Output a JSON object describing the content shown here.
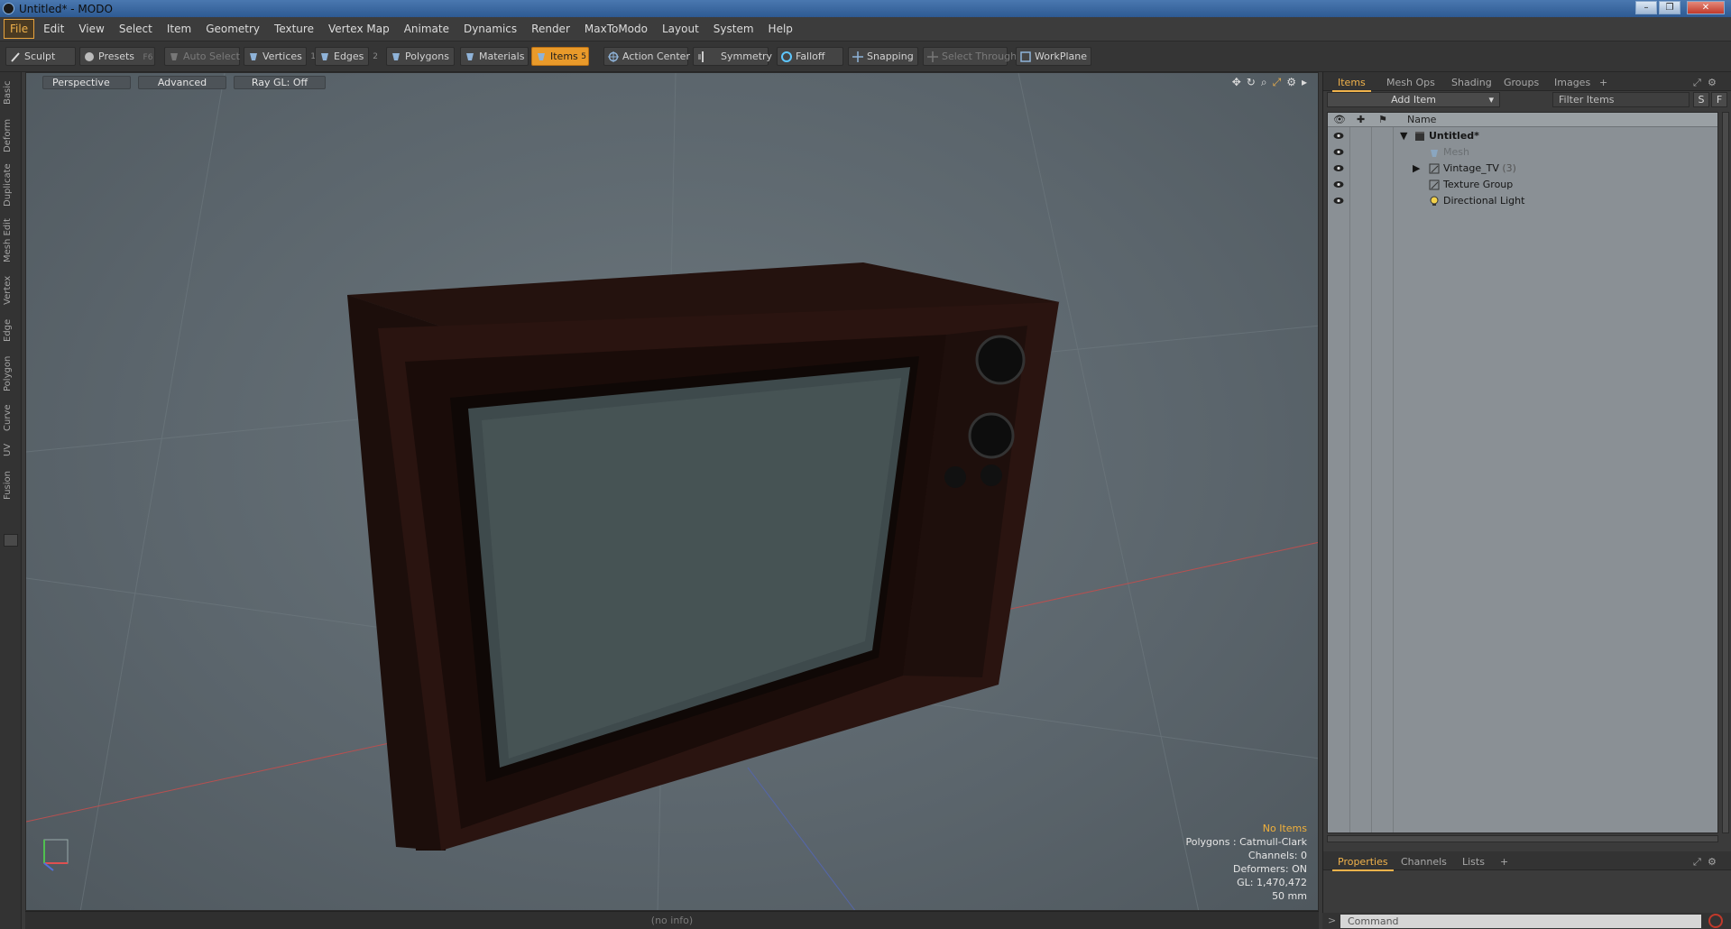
{
  "window": {
    "title": "Untitled* - MODO"
  },
  "menu": [
    "File",
    "Edit",
    "View",
    "Select",
    "Item",
    "Geometry",
    "Texture",
    "Vertex Map",
    "Animate",
    "Dynamics",
    "Render",
    "MaxToModo",
    "Layout",
    "System",
    "Help"
  ],
  "toolbar": {
    "sculpt": "Sculpt",
    "presets": "Presets",
    "presets_key": "F6",
    "auto_select": "Auto Select",
    "vertices": "Vertices",
    "vertices_num": "1",
    "edges": "Edges",
    "edges_num": "2",
    "polygons": "Polygons",
    "materials": "Materials",
    "items": "Items",
    "items_num": "5",
    "action_center": "Action Center",
    "symmetry": "Symmetry",
    "falloff": "Falloff",
    "snapping": "Snapping",
    "select_through": "Select Through",
    "workplane": "WorkPlane"
  },
  "left_tabs": [
    "Basic",
    "Deform",
    "Duplicate",
    "Mesh Edit",
    "Vertex",
    "Edge",
    "Polygon",
    "Curve",
    "UV",
    "Fusion"
  ],
  "viewport": {
    "view": "Perspective",
    "shading": "Advanced",
    "raygl": "Ray GL: Off",
    "info": {
      "selection": "No Items",
      "polygons": "Polygons : Catmull-Clark",
      "channels": "Channels: 0",
      "deformers": "Deformers: ON",
      "gl": "GL: 1,470,472",
      "lens": "50 mm"
    }
  },
  "status": {
    "text": "(no info)"
  },
  "right_panel": {
    "tabs": [
      "Items",
      "Mesh Ops",
      "Shading",
      "Groups",
      "Images"
    ],
    "add_item": "Add Item",
    "filter_placeholder": "Filter Items",
    "btn_s": "S",
    "btn_f": "F",
    "col_name": "Name",
    "items": [
      {
        "label": "Untitled*",
        "count": ""
      },
      {
        "label": "Mesh",
        "count": ""
      },
      {
        "label": "Vintage_TV",
        "count": "(3)"
      },
      {
        "label": "Texture Group",
        "count": ""
      },
      {
        "label": "Directional Light",
        "count": ""
      }
    ],
    "bottom_tabs": [
      "Properties",
      "Channels",
      "Lists"
    ],
    "command_placeholder": "Command"
  },
  "colors": {
    "accent": "#f0b24b",
    "viewport_bg": "#5f6a70",
    "tv_wood": "#2a1510"
  }
}
